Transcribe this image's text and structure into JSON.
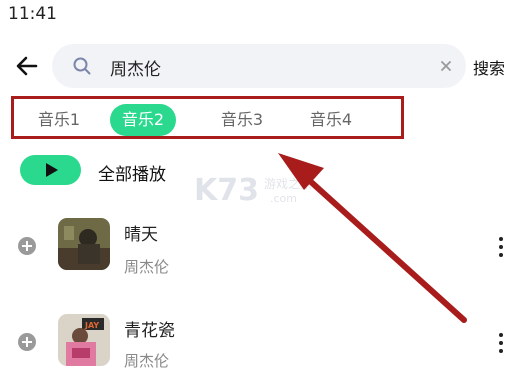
{
  "status_bar": {
    "time": "11:41"
  },
  "search": {
    "query": "周杰伦",
    "submit_label": "搜索"
  },
  "tabs": [
    {
      "label": "音乐1",
      "active": false
    },
    {
      "label": "音乐2",
      "active": true
    },
    {
      "label": "音乐3",
      "active": false
    },
    {
      "label": "音乐4",
      "active": false
    }
  ],
  "play_all_label": "全部播放",
  "songs": [
    {
      "title": "晴天",
      "artist": "周杰伦"
    },
    {
      "title": "青花瓷",
      "artist": "周杰伦"
    }
  ],
  "colors": {
    "accent": "#2bd98e",
    "annotation": "#a81c1c"
  }
}
